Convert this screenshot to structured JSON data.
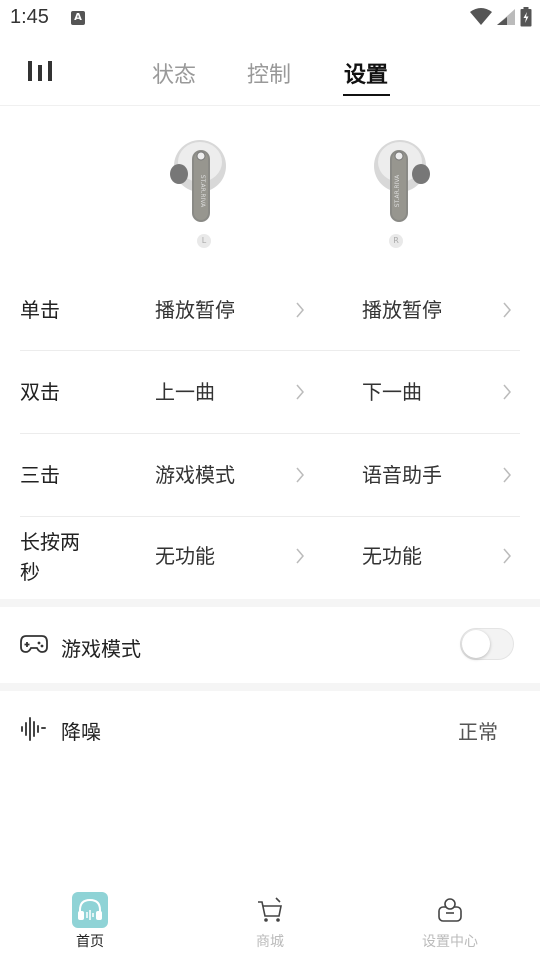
{
  "status_bar": {
    "time": "1:45",
    "notification_badge": "A"
  },
  "tabs": [
    {
      "label": "状态",
      "active": false
    },
    {
      "label": "控制",
      "active": false
    },
    {
      "label": "设置",
      "active": true
    }
  ],
  "earbuds": {
    "left_label": "L",
    "right_label": "R"
  },
  "gesture_settings": [
    {
      "label": "单击",
      "left": "播放暂停",
      "right": "播放暂停"
    },
    {
      "label": "双击",
      "left": "上一曲",
      "right": "下一曲"
    },
    {
      "label": "三击",
      "left": "游戏模式",
      "right": "语音助手"
    },
    {
      "label": "长按两秒",
      "left": "无功能",
      "right": "无功能"
    }
  ],
  "game_mode": {
    "label": "游戏模式",
    "enabled": false
  },
  "noise_cancel": {
    "label": "降噪",
    "value": "正常"
  },
  "bottom_nav": [
    {
      "label": "首页",
      "icon": "headphones-icon",
      "active": true
    },
    {
      "label": "商城",
      "icon": "cart-icon",
      "active": false
    },
    {
      "label": "设置中心",
      "icon": "settings-center-icon",
      "active": false
    }
  ],
  "colors": {
    "accent": "#8fd3d6",
    "active_text": "#111111",
    "inactive_text": "#999999"
  }
}
